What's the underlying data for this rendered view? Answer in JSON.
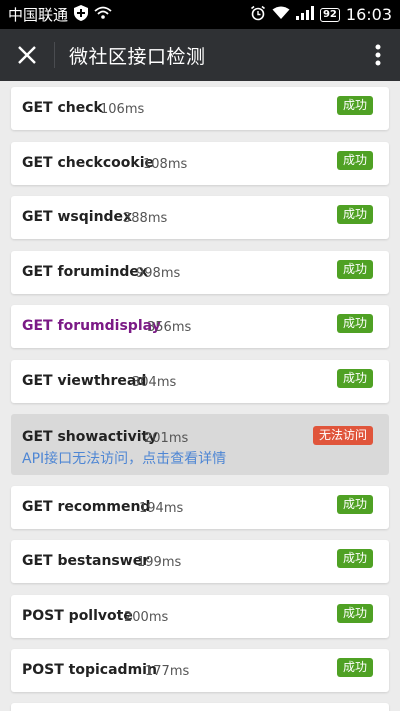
{
  "status_bar": {
    "carrier": "中国联通",
    "battery": "92",
    "time": "16:03"
  },
  "header": {
    "title": "微社区接口检测",
    "close_icon": "close-icon",
    "more_icon": "more-vertical-icon"
  },
  "checks": [
    {
      "label": "GET check",
      "time": "106ms",
      "status": "成功"
    },
    {
      "label": "GET checkcookie",
      "time": "108ms",
      "status": "成功"
    },
    {
      "label": "GET wsqindex",
      "time": "388ms",
      "status": "成功"
    },
    {
      "label": "GET forumindex",
      "time": "998ms",
      "status": "成功"
    },
    {
      "label": "GET forumdisplay",
      "time": "356ms",
      "status": "成功"
    },
    {
      "label": "GET viewthread",
      "time": "304ms",
      "status": "成功"
    },
    {
      "label": "GET showactivity",
      "time": "201ms",
      "status": "无法访问",
      "detail": "API接口无法访问，点击查看详情"
    },
    {
      "label": "GET recommend",
      "time": "194ms",
      "status": "成功"
    },
    {
      "label": "GET bestanswer",
      "time": "199ms",
      "status": "成功"
    },
    {
      "label": "POST pollvote",
      "time": "200ms",
      "status": "成功"
    },
    {
      "label": "POST topicadmin",
      "time": "177ms",
      "status": "成功"
    }
  ],
  "colors": {
    "success": "#4fa124",
    "error": "#e0553b",
    "link": "#4e86d4",
    "visited": "#7b1a86"
  }
}
